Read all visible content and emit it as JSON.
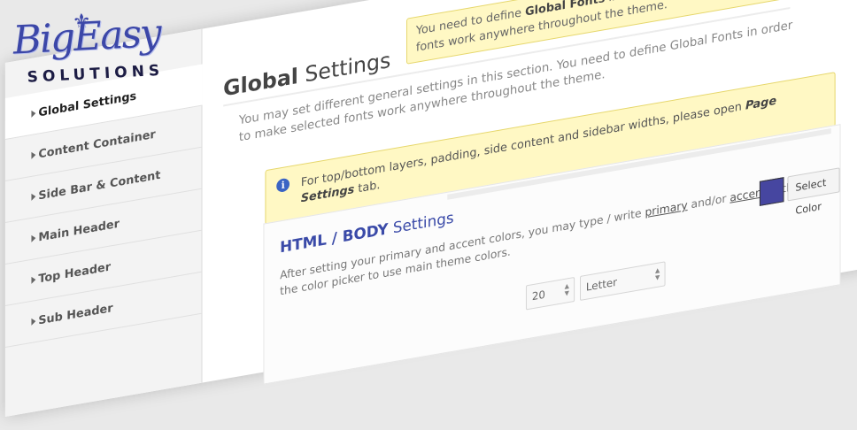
{
  "logo": {
    "line1": "BigEasy",
    "line2": "SOLUTIONS",
    "fleur": "⚜"
  },
  "sidebar": {
    "items": [
      {
        "label": "Global Settings",
        "active": true
      },
      {
        "label": "Content Container"
      },
      {
        "label": "Side Bar & Content"
      },
      {
        "label": "Main Header"
      },
      {
        "label": "Top Header"
      },
      {
        "label": "Sub Header"
      }
    ]
  },
  "main": {
    "title_bold": "Global",
    "title_rest": " Settings",
    "intro": "You may set different general settings in this section. You need to define Global Fonts in order to make selected fonts work anywhere throughout the theme.",
    "notice_top": {
      "pre": "You need to define ",
      "bold": "Global Fonts",
      "post": " in order to make selected fonts work anywhere throughout the theme."
    },
    "notice_info": {
      "icon": "i",
      "pre": "For top/bottom layers, padding, side content and sidebar widths, please open ",
      "bold": "Page Settings",
      "post": " tab."
    },
    "section": {
      "title_bold": "HTML / BODY",
      "title_rest": " Settings",
      "desc_pre": "After setting your primary and accent colors, you may type / write ",
      "desc_primary": "primary",
      "desc_mid": " and/or ",
      "desc_accent": "accent",
      "desc_post": " within the color picker to use main theme colors.",
      "swatch_color": "#4646a0",
      "select_color_label": "Select Color",
      "size_value": "20",
      "paper_value": "Letter"
    }
  }
}
